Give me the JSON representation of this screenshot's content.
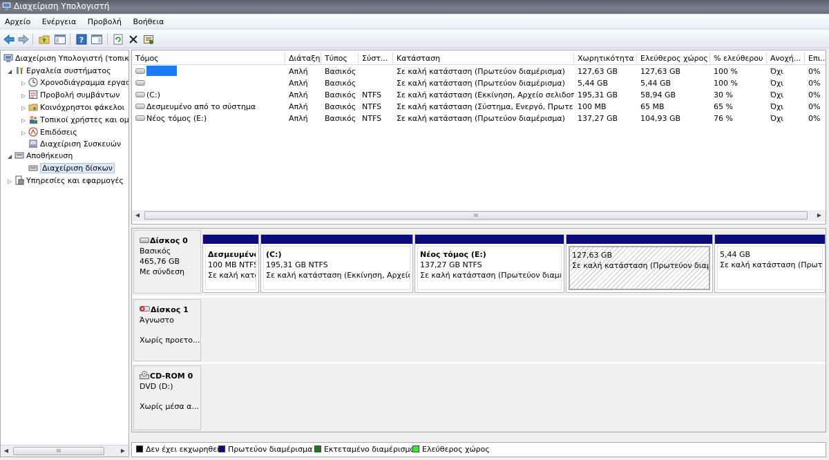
{
  "window": {
    "title": "Διαχείριση Υπολογιστή"
  },
  "menu": [
    "Αρχείο",
    "Ενέργεια",
    "Προβολή",
    "Βοήθεια"
  ],
  "tree": {
    "items": [
      {
        "label": "Διαχείριση Υπολογιστή (τοπικ",
        "level": 0,
        "icon": "computer-management-icon"
      },
      {
        "label": "Εργαλεία συστήματος",
        "level": 1,
        "icon": "system-tools-icon"
      },
      {
        "label": "Χρονοδιάγραμμα εργασ",
        "level": 2,
        "icon": "task-scheduler-icon"
      },
      {
        "label": "Προβολή συμβάντων",
        "level": 2,
        "icon": "event-viewer-icon"
      },
      {
        "label": "Κοινόχρηστοι φάκελοι",
        "level": 2,
        "icon": "shared-folders-icon"
      },
      {
        "label": "Τοπικοί χρήστες και ομ",
        "level": 2,
        "icon": "local-users-icon"
      },
      {
        "label": "Επιδόσεις",
        "level": 2,
        "icon": "performance-icon"
      },
      {
        "label": "Διαχείριση Συσκευών",
        "level": 2,
        "icon": "device-manager-icon"
      },
      {
        "label": "Αποθήκευση",
        "level": 1,
        "icon": "storage-icon"
      },
      {
        "label": "Διαχείριση δίσκων",
        "level": 2,
        "icon": "disk-management-icon",
        "selected": true
      },
      {
        "label": "Υπηρεσίες και εφαρμογές",
        "level": 1,
        "icon": "services-apps-icon"
      }
    ]
  },
  "volumes": {
    "columns": [
      "Τόμος",
      "Διάταξη",
      "Τύπος",
      "Σύστ...",
      "Κατάσταση",
      "Χωρητικότητα",
      "Ελεύθερος χώρος",
      "% ελεύθερου",
      "Ανοχή...",
      "Επι..."
    ],
    "rows": [
      [
        "",
        "Απλή",
        "Βασικός",
        "",
        "Σε καλή κατάσταση (Πρωτεύον διαμέρισμα)",
        "127,63 GB",
        "127,63 GB",
        "100 %",
        "Όχι",
        "0%"
      ],
      [
        "",
        "Απλή",
        "Βασικός",
        "",
        "Σε καλή κατάσταση (Πρωτεύον διαμέρισμα)",
        "5,44 GB",
        "5,44 GB",
        "100 %",
        "Όχι",
        "0%"
      ],
      [
        "(C:)",
        "Απλή",
        "Βασικός",
        "NTFS",
        "Σε καλή κατάσταση (Εκκίνηση, Αρχείο σελιδοπ...",
        "195,31 GB",
        "58,94 GB",
        "30 %",
        "Όχι",
        "0%"
      ],
      [
        "Δεσμευμένο από το σύστημα",
        "Απλή",
        "Βασικός",
        "NTFS",
        "Σε καλή κατάσταση (Σύστημα, Ενεργό, Πρωτε...",
        "100 MB",
        "65 MB",
        "65 %",
        "Όχι",
        "0%"
      ],
      [
        "Νέος τόμος (E:)",
        "Απλή",
        "Βασικός",
        "NTFS",
        "Σε καλή κατάσταση (Πρωτεύον διαμέρισμα)",
        "137,27 GB",
        "104,93 GB",
        "76 %",
        "Όχι",
        "0%"
      ]
    ]
  },
  "disks": [
    {
      "name": "Δίσκος 0",
      "type": "Βασικός",
      "size": "465,76 GB",
      "status": "Με σύνδεση",
      "partitions": [
        {
          "name": "Δεσμευμένο",
          "size": "100 MB NTFS",
          "status": "Σε καλή κατά"
        },
        {
          "name": "(C:)",
          "size": "195,31 GB NTFS",
          "status": "Σε καλή κατάσταση (Εκκίνηση, Αρχείο σ"
        },
        {
          "name": "Νέος τόμος  (E:)",
          "size": "137,27 GB NTFS",
          "status": "Σε καλή κατάσταση (Πρωτεύον διαμέρ"
        },
        {
          "name": "",
          "size": "127,63 GB",
          "status": "Σε καλή κατάσταση (Πρωτεύον διαμέρ"
        },
        {
          "name": "",
          "size": "5,44 GB",
          "status": "Σε καλή κατάσταση (Πρωτε"
        }
      ]
    },
    {
      "name": "Δίσκος 1",
      "type": "Άγνωστο",
      "size": "",
      "status": "Χωρίς προετο..."
    },
    {
      "name": "CD-ROM 0",
      "type": "DVD (D:)",
      "size": "",
      "status": "Χωρίς μέσα α..."
    }
  ],
  "legend": [
    {
      "label": "Δεν έχει εκχωρηθεί",
      "color": "#000000"
    },
    {
      "label": "Πρωτεύον διαμέρισμα",
      "color": "#0a0a7a"
    },
    {
      "label": "Εκτεταμένο διαμέρισμα",
      "color": "#1a7a1a"
    },
    {
      "label": "Ελεύθερος χώρος",
      "color": "#33ee33"
    }
  ],
  "scroll_glyph": "III"
}
